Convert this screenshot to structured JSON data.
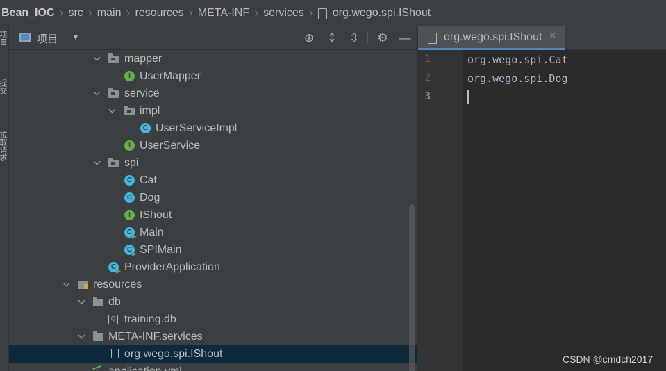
{
  "breadcrumb": {
    "items": [
      "Bean_IOC",
      "src",
      "main",
      "resources",
      "META-INF",
      "services",
      "org.wego.spi.IShout"
    ]
  },
  "toolstrip": {
    "tabs": [
      "项目",
      "提交",
      "拉取请求"
    ]
  },
  "project_panel": {
    "title": "项目",
    "header_icons": [
      "locate-icon",
      "expand-all-icon",
      "collapse-all-icon",
      "gear-icon",
      "minimize-icon"
    ]
  },
  "tree": {
    "rows": [
      {
        "label": "mapper",
        "icon": "folder-icon",
        "expanded": true
      },
      {
        "label": "UserMapper",
        "icon": "interface-icon"
      },
      {
        "label": "service",
        "icon": "folder-icon",
        "expanded": true
      },
      {
        "label": "impl",
        "icon": "folder-icon",
        "expanded": true
      },
      {
        "label": "UserServiceImpl",
        "icon": "class-icon"
      },
      {
        "label": "UserService",
        "icon": "interface-icon"
      },
      {
        "label": "spi",
        "icon": "folder-icon",
        "expanded": true
      },
      {
        "label": "Cat",
        "icon": "class-icon"
      },
      {
        "label": "Dog",
        "icon": "class-icon"
      },
      {
        "label": "IShout",
        "icon": "interface-icon"
      },
      {
        "label": "Main",
        "icon": "runnable-class-icon"
      },
      {
        "label": "SPIMain",
        "icon": "runnable-class-icon"
      },
      {
        "label": "ProviderApplication",
        "icon": "spring-app-icon"
      },
      {
        "label": "resources",
        "icon": "resources-folder-icon",
        "expanded": true
      },
      {
        "label": "db",
        "icon": "folder-icon",
        "expanded": true
      },
      {
        "label": "training.db",
        "icon": "database-file-icon"
      },
      {
        "label": "META-INF.services",
        "icon": "folder-icon",
        "expanded": true
      },
      {
        "label": "org.wego.spi.IShout",
        "icon": "file-icon",
        "selected": true
      },
      {
        "label": "application.yml",
        "icon": "yaml-file-icon"
      }
    ]
  },
  "editor": {
    "tab_label": "org.wego.spi.IShout",
    "close_glyph": "×",
    "line_numbers": [
      "1",
      "2",
      "3"
    ],
    "lines": [
      "org.wego.spi.Cat",
      "org.wego.spi.Dog",
      ""
    ]
  },
  "watermark": "CSDN @cmdch2017",
  "colors": {
    "selection": "#0d293e",
    "interface": "#62b543",
    "class": "#40b6e0",
    "tab_underline": "#4a88c7"
  }
}
